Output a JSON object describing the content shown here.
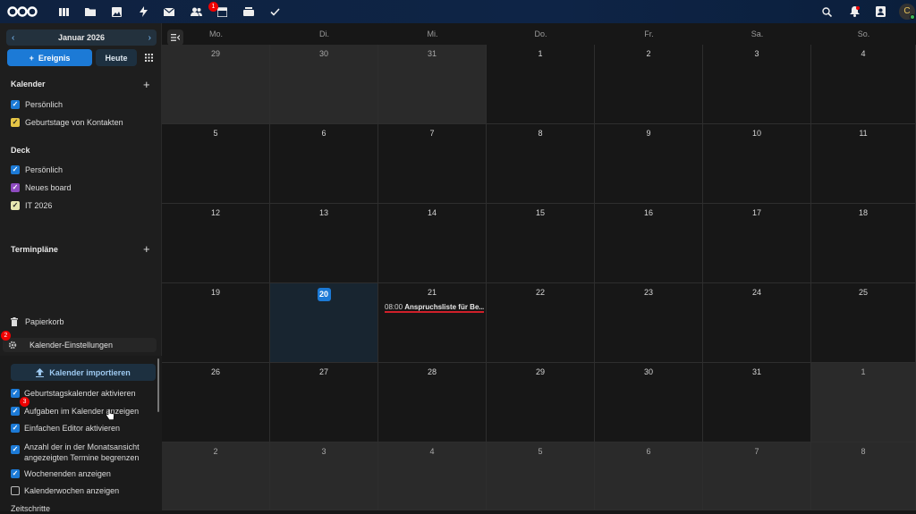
{
  "topbar": {
    "apps": [
      {
        "icon": "dashboard-icon"
      },
      {
        "icon": "files-icon"
      },
      {
        "icon": "photos-icon"
      },
      {
        "icon": "activity-icon"
      },
      {
        "icon": "mail-icon"
      },
      {
        "icon": "contacts-icon"
      },
      {
        "icon": "calendar-icon",
        "badge": "1"
      },
      {
        "icon": "deck-icon"
      },
      {
        "icon": "tasks-icon"
      }
    ],
    "notifications_badge": "",
    "avatar_letter": "C"
  },
  "sidebar": {
    "month_label": "Januar 2026",
    "new_event_label": "Ereignis",
    "today_label": "Heute",
    "calendars_title": "Kalender",
    "calendars": [
      {
        "label": "Persönlich",
        "color": "#1c7ad6"
      },
      {
        "label": "Geburtstage von Kontakten",
        "color": "#e5c545"
      }
    ],
    "deck_title": "Deck",
    "deck": [
      {
        "label": "Persönlich",
        "color": "#1c7ad6"
      },
      {
        "label": "Neues board",
        "color": "#8e4bbf"
      },
      {
        "label": "IT 2026",
        "color": "#e8e8b0"
      }
    ],
    "schedules_title": "Terminpläne",
    "trash_label": "Papierkorb",
    "settings_label": "Kalender-Einstellungen",
    "settings_badge": "2",
    "import_label": "Kalender importieren",
    "options": [
      {
        "label": "Geburtstagskalender aktivieren",
        "checked": true
      },
      {
        "label": "Aufgaben im Kalender anzeigen",
        "checked": true,
        "badge": "3"
      },
      {
        "label": "Einfachen Editor aktivieren",
        "checked": true
      },
      {
        "label": "Anzahl der in der Monatsansicht angezeigten Termine begrenzen",
        "checked": true
      },
      {
        "label": "Wochenenden anzeigen",
        "checked": true
      },
      {
        "label": "Kalenderwochen anzeigen",
        "checked": false
      }
    ],
    "cutoff_label": "Zeitschritte"
  },
  "calendar": {
    "weekdays": [
      "Mo.",
      "Di.",
      "Mi.",
      "Do.",
      "Fr.",
      "Sa.",
      "So."
    ],
    "weeks": [
      [
        "29",
        "30",
        "31",
        "1",
        "2",
        "3",
        "4"
      ],
      [
        "5",
        "6",
        "7",
        "8",
        "9",
        "10",
        "11"
      ],
      [
        "12",
        "13",
        "14",
        "15",
        "16",
        "17",
        "18"
      ],
      [
        "19",
        "20",
        "21",
        "22",
        "23",
        "24",
        "25"
      ],
      [
        "26",
        "27",
        "28",
        "29",
        "30",
        "31",
        "1"
      ],
      [
        "2",
        "3",
        "4",
        "5",
        "6",
        "7",
        "8"
      ]
    ],
    "today": "20",
    "event": {
      "time": "08:00",
      "title": "Anspruchsliste für Be..."
    }
  },
  "colors": {
    "accent": "#1c7ad6",
    "event_underline": "#d0202a",
    "badge": "#e00000"
  }
}
